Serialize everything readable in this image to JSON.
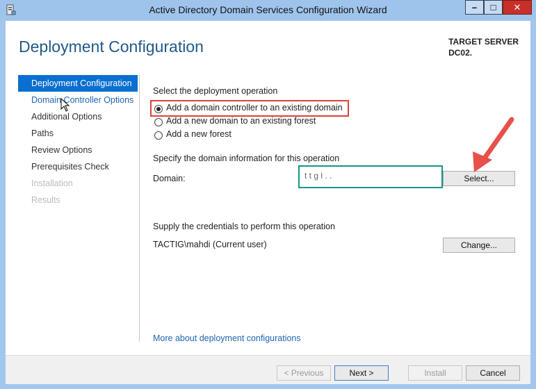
{
  "window": {
    "title": "Active Directory Domain Services Configuration Wizard",
    "controls": {
      "minimize": "–",
      "maximize": "□",
      "close": "✕"
    }
  },
  "header": {
    "page_title": "Deployment Configuration",
    "target_label": "TARGET SERVER",
    "target_value": "DC02."
  },
  "nav": {
    "items": [
      {
        "label": "Deployment Configuration",
        "state": "active"
      },
      {
        "label": "Domain Controller Options",
        "state": "link"
      },
      {
        "label": "Additional Options",
        "state": "normal"
      },
      {
        "label": "Paths",
        "state": "normal"
      },
      {
        "label": "Review Options",
        "state": "normal"
      },
      {
        "label": "Prerequisites Check",
        "state": "normal"
      },
      {
        "label": "Installation",
        "state": "disabled"
      },
      {
        "label": "Results",
        "state": "disabled"
      }
    ]
  },
  "operation": {
    "heading": "Select the deployment operation",
    "options": [
      {
        "label": "Add a domain controller to an existing domain",
        "checked": true
      },
      {
        "label": "Add a new domain to an existing forest",
        "checked": false
      },
      {
        "label": "Add a new forest",
        "checked": false
      }
    ]
  },
  "domain": {
    "heading": "Specify the domain information for this operation",
    "label": "Domain:",
    "value": "t  t  g  l  .  .",
    "select_button": "Select..."
  },
  "credentials": {
    "heading": "Supply the credentials to perform this operation",
    "user": "TACTIG\\mahdi (Current user)",
    "change_button": "Change..."
  },
  "more_link": "More about deployment configurations",
  "footer": {
    "previous": "< Previous",
    "next": "Next >",
    "install": "Install",
    "cancel": "Cancel"
  },
  "colors": {
    "accent": "#0a6fd1",
    "highlight_red": "#e0403a",
    "highlight_teal": "#13948a",
    "arrow": "#e8504a"
  }
}
